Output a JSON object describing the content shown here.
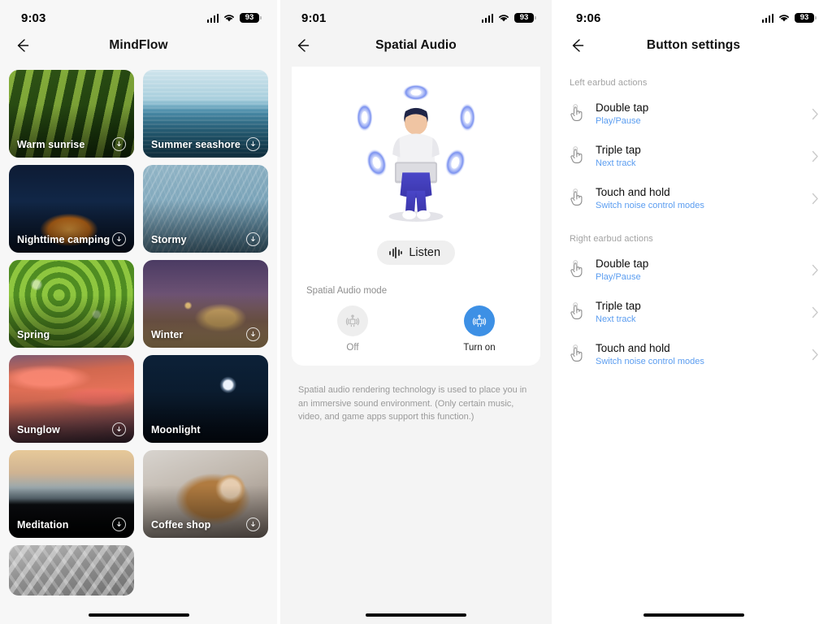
{
  "screens": [
    {
      "name": "mindflow",
      "status": {
        "time": "9:03",
        "battery": "93",
        "signal_icon": "cellular-bars-icon",
        "wifi_icon": "wifi-icon",
        "battery_icon": "battery-pill-icon"
      },
      "nav": {
        "back_icon": "back-arrow-icon",
        "title": "MindFlow"
      },
      "tiles": [
        {
          "label": "Warm sunrise",
          "art": "art-warm-sunrise",
          "download": true
        },
        {
          "label": "Summer seashore",
          "art": "art-summer-seashore",
          "download": true
        },
        {
          "label": "Nighttime camping",
          "art": "art-nighttime-camping",
          "download": true
        },
        {
          "label": "Stormy",
          "art": "art-stormy",
          "download": true
        },
        {
          "label": "Spring",
          "art": "art-spring",
          "download": false
        },
        {
          "label": "Winter",
          "art": "art-winter",
          "download": true
        },
        {
          "label": "Sunglow",
          "art": "art-sunglow",
          "download": true
        },
        {
          "label": "Moonlight",
          "art": "art-moonlight",
          "download": false
        },
        {
          "label": "Meditation",
          "art": "art-meditation",
          "download": true
        },
        {
          "label": "Coffee shop",
          "art": "art-coffee-shop",
          "download": true
        },
        {
          "label": "",
          "art": "art-clouds",
          "download": false,
          "partial": true
        }
      ]
    },
    {
      "name": "spatial-audio",
      "status": {
        "time": "9:01",
        "battery": "93"
      },
      "nav": {
        "title": "Spatial Audio"
      },
      "hero_icon": "spatial-audio-person-illustration",
      "listen_button": {
        "label": "Listen",
        "icon": "waveform-icon"
      },
      "mode_label": "Spatial Audio mode",
      "modes": [
        {
          "key": "off",
          "caption": "Off",
          "icon": "spatial-audio-off-icon",
          "active": false
        },
        {
          "key": "turnon",
          "caption": "Turn on",
          "icon": "spatial-audio-on-icon",
          "active": true
        }
      ],
      "description": "Spatial audio rendering technology is used to place you in an immersive sound environment. (Only certain music, video, and game apps support this function.)"
    },
    {
      "name": "button-settings",
      "status": {
        "time": "9:06",
        "battery": "93"
      },
      "nav": {
        "title": "Button settings"
      },
      "sections": [
        {
          "heading": "Left earbud actions",
          "rows": [
            {
              "title": "Double tap",
              "value": "Play/Pause",
              "icon": "tap-gesture-icon",
              "chevron": "chevron-right-icon"
            },
            {
              "title": "Triple tap",
              "value": "Next track",
              "icon": "triple-tap-gesture-icon",
              "chevron": "chevron-right-icon"
            },
            {
              "title": "Touch and hold",
              "value": "Switch noise control modes",
              "icon": "touch-hold-gesture-icon",
              "chevron": "chevron-right-icon"
            }
          ]
        },
        {
          "heading": "Right earbud actions",
          "rows": [
            {
              "title": "Double tap",
              "value": "Play/Pause",
              "icon": "tap-gesture-icon",
              "chevron": "chevron-right-icon"
            },
            {
              "title": "Triple tap",
              "value": "Next track",
              "icon": "triple-tap-gesture-icon",
              "chevron": "chevron-right-icon"
            },
            {
              "title": "Touch and hold",
              "value": "Switch noise control modes",
              "icon": "touch-hold-gesture-icon",
              "chevron": "chevron-right-icon"
            }
          ]
        }
      ]
    }
  ],
  "colors": {
    "accent_blue": "#3d90e5",
    "link_blue": "#5b9df0",
    "page_bg": "#f4f4f4",
    "card_bg": "#ffffff",
    "muted_text": "#9a9a9a"
  }
}
